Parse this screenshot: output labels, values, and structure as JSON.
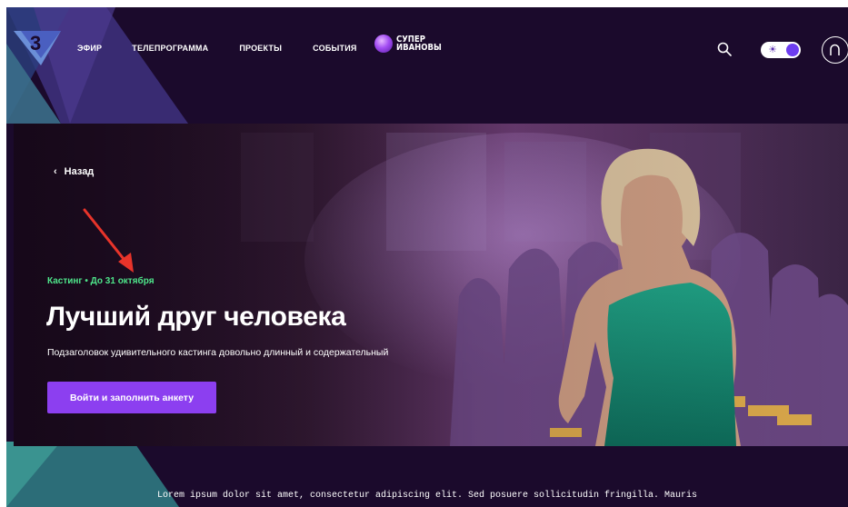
{
  "header": {
    "logo_text": "3",
    "nav": [
      "ЭФИР",
      "ТЕЛЕПРОГРАММА",
      "ПРОЕКТЫ",
      "СОБЫТИЯ"
    ],
    "brand": {
      "line1": "СУПЕР",
      "line2": "ИВАНОВЫ"
    },
    "theme_toggle": {
      "sun": "☀"
    }
  },
  "hero": {
    "back_icon": "‹",
    "back_label": "Назад",
    "tagline": "Кастинг • До 31 октября",
    "title": "Лучший друг человека",
    "subtitle": "Подзаголовок удивительного кастинга довольно длинный и содержательный",
    "cta_label": "Войти и заполнить анкету"
  },
  "footer": {
    "text": "Lorem ipsum dolor sit amet, consectetur adipiscing elit. Sed posuere sollicitudin fringilla. Mauris"
  },
  "colors": {
    "background": "#1b0a2c",
    "accent": "#8c3ff0",
    "tagline": "#4ee58a",
    "annotation_arrow": "#e8342a"
  },
  "icons": [
    "search-icon",
    "sun-icon",
    "moon-knob",
    "user-icon",
    "chevron-left-icon",
    "annotation-arrow"
  ]
}
